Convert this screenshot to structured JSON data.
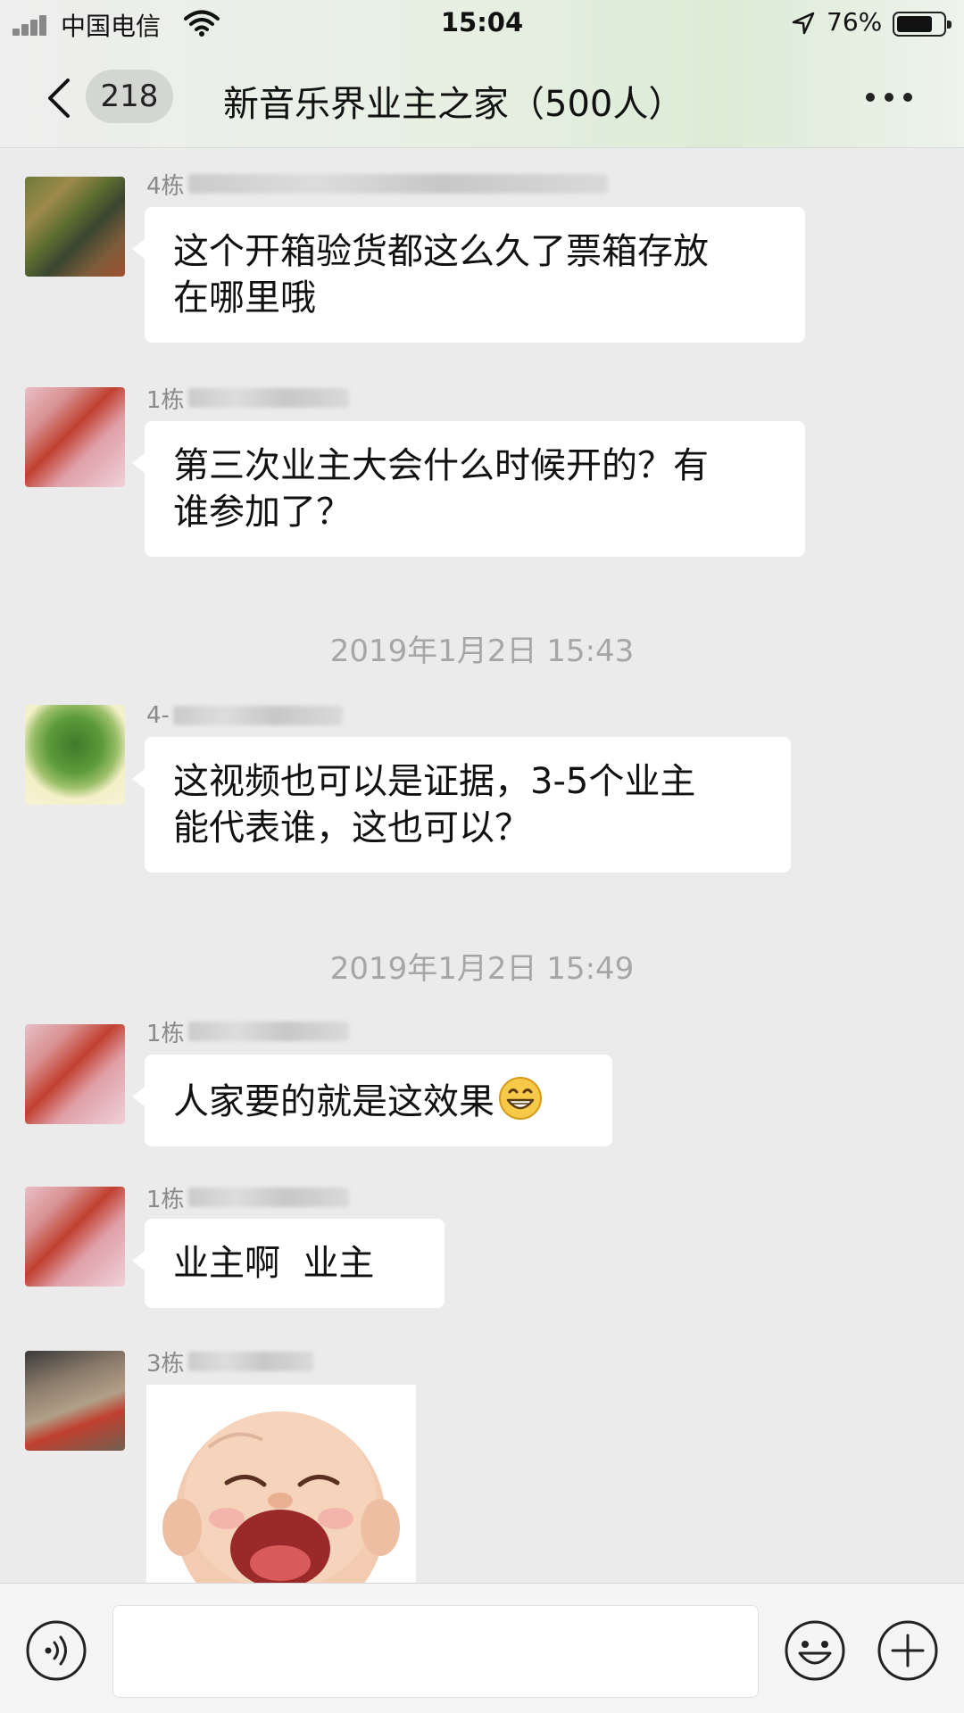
{
  "status_bar": {
    "carrier": "中国电信",
    "time": "15:04",
    "battery_percent": "76%",
    "battery_level": 0.76,
    "icons": [
      "signal-icon",
      "wifi-icon",
      "location-arrow-icon",
      "battery-icon"
    ]
  },
  "header": {
    "back_icon": "chevron-left-icon",
    "unread_count": "218",
    "title": "新音乐界业主之家（500人）",
    "more_icon": "more-dots-icon"
  },
  "messages": [
    {
      "sender_prefix": "4栋",
      "text": "这个开箱验货都这么久了票箱存放\n在哪里哦"
    },
    {
      "sender_prefix": "1栋",
      "text": "第三次业主大会什么时候开的？有\n谁参加了？"
    },
    {
      "timestamp": "2019年1月2日 15:43"
    },
    {
      "sender_prefix": "4-",
      "text": "这视频也可以是证据，3-5个业主\n能代表谁，这也可以？"
    },
    {
      "timestamp": "2019年1月2日 15:49"
    },
    {
      "sender_prefix": "1栋",
      "text": "人家要的就是这效果",
      "emoji": "grinning-face-icon"
    },
    {
      "sender_prefix": "1栋",
      "text": "业主啊  业主"
    },
    {
      "sender_prefix": "3栋",
      "sticker": "laughing-baby-sticker"
    }
  ],
  "input_bar": {
    "voice_icon": "voice-icon",
    "emoji_icon": "emoji-icon",
    "plus_icon": "plus-icon"
  },
  "colors": {
    "chat_background": "#ebebeb",
    "bubble": "#ffffff",
    "header_tint": "#dcebd6",
    "timestamp_text": "#a6a6a6"
  }
}
